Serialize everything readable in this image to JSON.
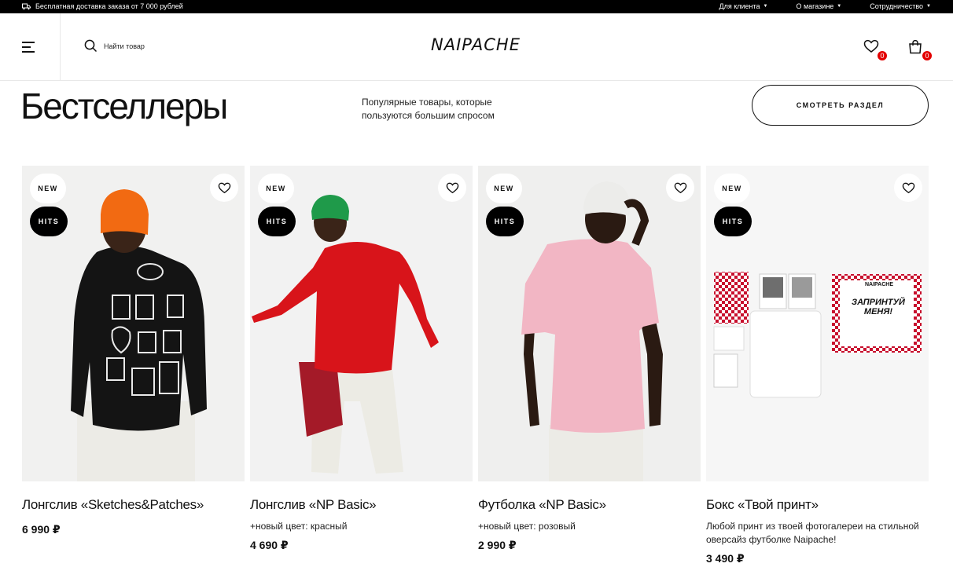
{
  "topbar": {
    "promo": "Бесплатная доставка заказа от 7 000 рублей",
    "links": [
      "Для клиента",
      "О магазине",
      "Сотрудничество"
    ]
  },
  "header": {
    "search_placeholder": "Найти товар",
    "logo": "NAIPACHE",
    "favorites_count": "0",
    "cart_count": "0"
  },
  "section": {
    "title": "Бестселлеры",
    "subtitle": "Популярные товары, которые пользуются большим спросом",
    "view_button": "Смотреть раздел"
  },
  "products": [
    {
      "name": "Лонгслив «Sketches&Patches»",
      "note": "",
      "price": "6 990 ₽",
      "tag_new": "NEW",
      "tag_hits": "HITS",
      "shirt_color": "#141414",
      "hat_color": "#f26a12"
    },
    {
      "name": "Лонгслив «NP Basic»",
      "note": "+новый цвет: красный",
      "price": "4 690 ₽",
      "tag_new": "NEW",
      "tag_hits": "HITS",
      "shirt_color": "#d8141a",
      "hat_color": "#1f9a4a"
    },
    {
      "name": "Футболка «NP Basic»",
      "note": "+новый цвет: розовый",
      "price": "2 990 ₽",
      "tag_new": "NEW",
      "tag_hits": "HITS",
      "shirt_color": "#f2b6c4",
      "hat_color": "#ececea"
    },
    {
      "name": "Бокс «Твой принт»",
      "note": "Любой принт из твоей фотогалереи на стильной оверсайз футболке Naipache!",
      "price": "3 490 ₽",
      "tag_new": "NEW",
      "tag_hits": "HITS",
      "box_text": "ЗАПРИНТУЙ МЕНЯ!",
      "box_brand": "NAIPACHE",
      "accent": "#c8102e"
    }
  ]
}
